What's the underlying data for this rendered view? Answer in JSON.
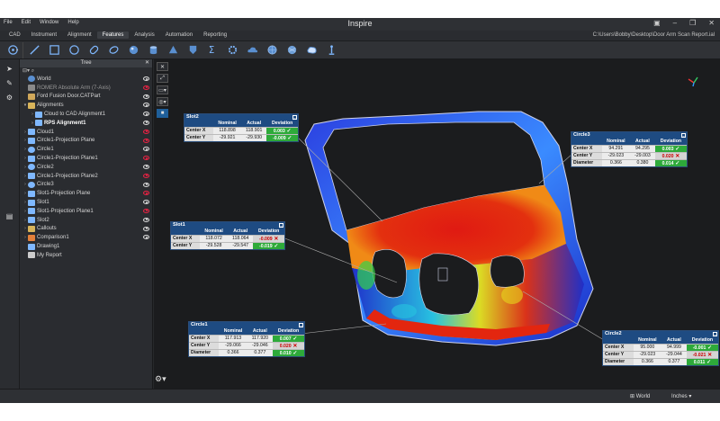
{
  "app": {
    "title": "Inspire",
    "menu": [
      "File",
      "Edit",
      "Window",
      "Help"
    ],
    "tabs": [
      "CAD",
      "Instrument",
      "Alignment",
      "Features",
      "Analysis",
      "Automation",
      "Reporting"
    ],
    "active_tab": "Features",
    "file_path": "C:\\Users\\Bobby\\Desktop\\Door Arm Scan Report.ial",
    "window_controls": [
      "minimize-icon",
      "maximize-icon",
      "close-icon"
    ]
  },
  "toolbar": {
    "icons": [
      "point-icon",
      "line-icon",
      "plane-icon",
      "circle-icon",
      "slot-icon",
      "ellipse-icon",
      "sphere-icon",
      "cylinder-icon",
      "cone-icon",
      "polygon-icon",
      "sigma-icon",
      "gear-icon",
      "cloud-icon",
      "mesh-icon",
      "mesh-cloud-icon",
      "wrench-icon"
    ]
  },
  "tree": {
    "title": "Tree",
    "items": [
      {
        "label": "World",
        "indent": 0,
        "icon": "world-icon",
        "eye": "normal",
        "exp": ""
      },
      {
        "label": "ROMER Absolute Arm (7-Axis)",
        "indent": 0,
        "icon": "arm-icon",
        "eye": "red",
        "exp": "",
        "dim": true
      },
      {
        "label": "Ford Fusion Door.CATPart",
        "indent": 0,
        "icon": "part-icon",
        "eye": "normal",
        "exp": ""
      },
      {
        "label": "Alignments",
        "indent": 0,
        "icon": "folder-icon",
        "eye": "normal",
        "exp": "▾"
      },
      {
        "label": "Cloud to CAD Alignment1",
        "indent": 1,
        "icon": "align-icon",
        "eye": "normal",
        "exp": "›"
      },
      {
        "label": "RPS Alignment1",
        "indent": 1,
        "icon": "align-icon",
        "eye": "normal",
        "exp": "›",
        "bold": true
      },
      {
        "label": "Cloud1",
        "indent": 0,
        "icon": "cloud-icon",
        "eye": "red",
        "exp": "›"
      },
      {
        "label": "Circle1-Projection Plane",
        "indent": 0,
        "icon": "plane-icon",
        "eye": "red",
        "exp": "›"
      },
      {
        "label": "Circle1",
        "indent": 0,
        "icon": "circle-icon",
        "eye": "normal",
        "exp": "›"
      },
      {
        "label": "Circle1-Projection Plane1",
        "indent": 0,
        "icon": "plane-icon",
        "eye": "red",
        "exp": "›"
      },
      {
        "label": "Circle2",
        "indent": 0,
        "icon": "circle-icon",
        "eye": "normal",
        "exp": "›"
      },
      {
        "label": "Circle1-Projection Plane2",
        "indent": 0,
        "icon": "plane-icon",
        "eye": "red",
        "exp": "›"
      },
      {
        "label": "Circle3",
        "indent": 0,
        "icon": "circle-icon",
        "eye": "normal",
        "exp": "›"
      },
      {
        "label": "Slot1-Projection Plane",
        "indent": 0,
        "icon": "plane-icon",
        "eye": "red",
        "exp": "›"
      },
      {
        "label": "Slot1",
        "indent": 0,
        "icon": "slot-icon",
        "eye": "normal",
        "exp": "›"
      },
      {
        "label": "Slot1-Projection Plane1",
        "indent": 0,
        "icon": "plane-icon",
        "eye": "red",
        "exp": "›"
      },
      {
        "label": "Slot2",
        "indent": 0,
        "icon": "slot-icon",
        "eye": "normal",
        "exp": "›"
      },
      {
        "label": "Callouts",
        "indent": 0,
        "icon": "folder-icon",
        "eye": "normal",
        "exp": "›"
      },
      {
        "label": "Comparison1",
        "indent": 0,
        "icon": "comparison-icon",
        "eye": "normal",
        "exp": "›"
      },
      {
        "label": "Drawing1",
        "indent": 0,
        "icon": "drawing-icon",
        "eye": "none",
        "exp": ""
      },
      {
        "label": "My Report",
        "indent": 0,
        "icon": "report-icon",
        "eye": "none",
        "exp": ""
      }
    ]
  },
  "callouts": {
    "headers": [
      "",
      "Nominal",
      "Actual",
      "Deviation"
    ],
    "slot2": {
      "title": "Slot2",
      "rows": [
        {
          "label": "Center X",
          "nominal": "118.898",
          "actual": "118.901",
          "deviation": "0.003",
          "ok": true
        },
        {
          "label": "Center Y",
          "nominal": "-29.921",
          "actual": "-29.930",
          "deviation": "-0.009",
          "ok": true
        }
      ]
    },
    "circle3": {
      "title": "Circle3",
      "rows": [
        {
          "label": "Center X",
          "nominal": "94.291",
          "actual": "94.295",
          "deviation": "0.003",
          "ok": true
        },
        {
          "label": "Center Y",
          "nominal": "-29.023",
          "actual": "-29.003",
          "deviation": "0.020",
          "ok": false
        },
        {
          "label": "Diameter",
          "nominal": "0.366",
          "actual": "0.380",
          "deviation": "0.014",
          "ok": true
        }
      ]
    },
    "slot1": {
      "title": "Slot1",
      "rows": [
        {
          "label": "Center X",
          "nominal": "118.072",
          "actual": "118.064",
          "deviation": "-0.009",
          "ok": false
        },
        {
          "label": "Center Y",
          "nominal": "-29.528",
          "actual": "-29.547",
          "deviation": "-0.019",
          "ok": true
        }
      ]
    },
    "circle1": {
      "title": "Circle1",
      "rows": [
        {
          "label": "Center X",
          "nominal": "117.913",
          "actual": "117.920",
          "deviation": "0.007",
          "ok": true
        },
        {
          "label": "Center Y",
          "nominal": "-29.066",
          "actual": "-29.046",
          "deviation": "0.020",
          "ok": false
        },
        {
          "label": "Diameter",
          "nominal": "0.366",
          "actual": "0.377",
          "deviation": "0.010",
          "ok": true
        }
      ]
    },
    "circle2": {
      "title": "Circle2",
      "rows": [
        {
          "label": "Center X",
          "nominal": "95.000",
          "actual": "94.999",
          "deviation": "-0.001",
          "ok": true
        },
        {
          "label": "Center Y",
          "nominal": "-29.023",
          "actual": "-29.044",
          "deviation": "-0.021",
          "ok": false
        },
        {
          "label": "Diameter",
          "nominal": "0.366",
          "actual": "0.377",
          "deviation": "0.011",
          "ok": true
        }
      ]
    }
  },
  "status": {
    "coordinate_system": "World",
    "units": "Inches"
  },
  "colors": {
    "ok": "#2eaa3a",
    "bad": "#cc0000",
    "header_blue": "#1e4b82"
  }
}
